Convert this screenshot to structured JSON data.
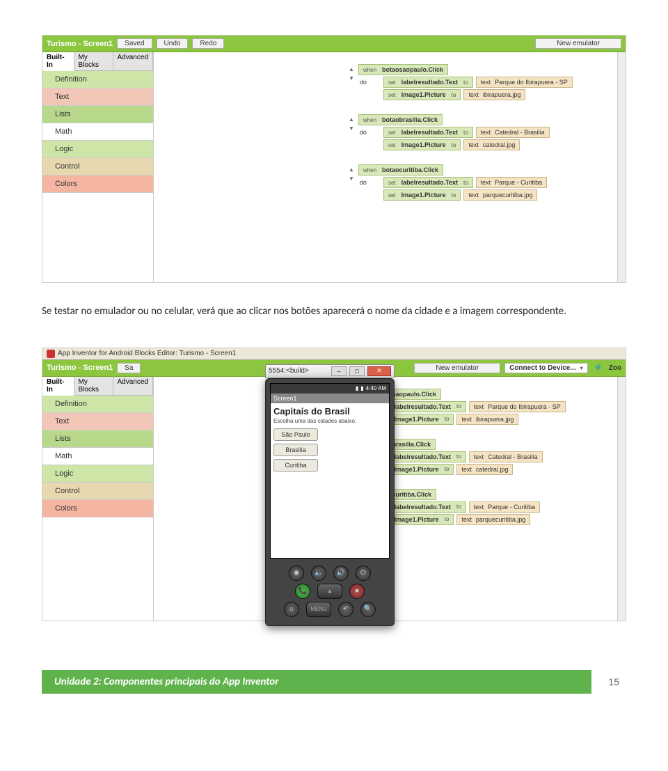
{
  "fig1": {
    "title": "Turismo - Screen1",
    "buttons": {
      "saved": "Saved",
      "undo": "Undo",
      "redo": "Redo",
      "newEmu": "New emulator"
    },
    "paletteTabs": {
      "builtin": "Built-In",
      "myblocks": "My Blocks",
      "advanced": "Advanced"
    },
    "drawers": {
      "definition": "Definition",
      "text": "Text",
      "lists": "Lists",
      "math": "Math",
      "logic": "Logic",
      "control": "Control",
      "colors": "Colors"
    }
  },
  "blocks": [
    {
      "when": "botaosaopaulo.Click",
      "sets": [
        {
          "target": "labelresultado.Text",
          "text": "Parque do Ibirapuera - SP"
        },
        {
          "target": "Image1.Picture",
          "text": "ibirapuera.jpg"
        }
      ]
    },
    {
      "when": "botaobrasilia.Click",
      "sets": [
        {
          "target": "labelresultado.Text",
          "text": "Catedral - Brasilia"
        },
        {
          "target": "Image1.Picture",
          "text": "catedral.jpg"
        }
      ]
    },
    {
      "when": "botaocuritiba.Click",
      "sets": [
        {
          "target": "labelresultado.Text",
          "text": "Parque - Curitiba"
        },
        {
          "target": "Image1.Picture",
          "text": "parquecuritiba.jpg"
        }
      ]
    }
  ],
  "paragraph": "Se testar no emulador ou no celular, verá que ao clicar nos botões aparecerá o nome da cidade e a imagem correspondente.",
  "fig2": {
    "javaTitle": "App Inventor for Android Blocks Editor: Turismo - Screen1",
    "emuWinTitle": "5554:<build>",
    "topbarTitle": "Turismo - Screen1",
    "savedShort": "Sa",
    "newEmu": "New emulator",
    "connect": "Connect to Device...",
    "zoom": "Zoo",
    "statusTime": "4:40 AM",
    "appbar": "Screen1",
    "appTitle": "Capitais do Brasil",
    "appSub": "Escolha uma das cidades abaixo:",
    "cityButtons": [
      "São Paulo",
      "Brasilia",
      "Curitiba"
    ],
    "hw": {
      "menu": "MENU"
    }
  },
  "kw": {
    "when": "when",
    "do": "do",
    "set": "set",
    "to": "to",
    "text": "text"
  },
  "footer": {
    "title": "Unidade 2: Componentes principais do App Inventor",
    "page": "15"
  }
}
